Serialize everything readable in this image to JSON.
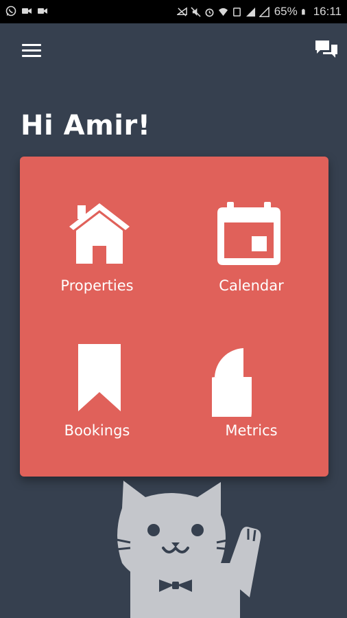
{
  "status_bar": {
    "left_icons": [
      "whatsapp-icon",
      "video-camera-icon",
      "video-camera-icon"
    ],
    "right_icons": [
      "no-signal-icon",
      "mute-icon",
      "alarm-icon",
      "wifi-icon",
      "data-icon",
      "signal-icon",
      "signal-icon"
    ],
    "battery": "65%",
    "time": "16:11"
  },
  "header": {
    "menu_icon": "hamburger-menu-icon",
    "chat_icon": "chat-icon"
  },
  "greeting": "Hi Amir!",
  "dashboard": {
    "tiles": [
      {
        "label": "Properties",
        "icon": "house-icon"
      },
      {
        "label": "Calendar",
        "icon": "calendar-icon"
      },
      {
        "label": "Bookings",
        "icon": "bookmark-icon"
      },
      {
        "label": "Metrics",
        "icon": "pie-chart-icon"
      }
    ]
  },
  "colors": {
    "background": "#36404f",
    "card": "#e0615a",
    "icon": "#ffffff",
    "mascot": "#c4c6cb",
    "status_bar": "#000000"
  },
  "mascot": "waving-cat-mascot"
}
